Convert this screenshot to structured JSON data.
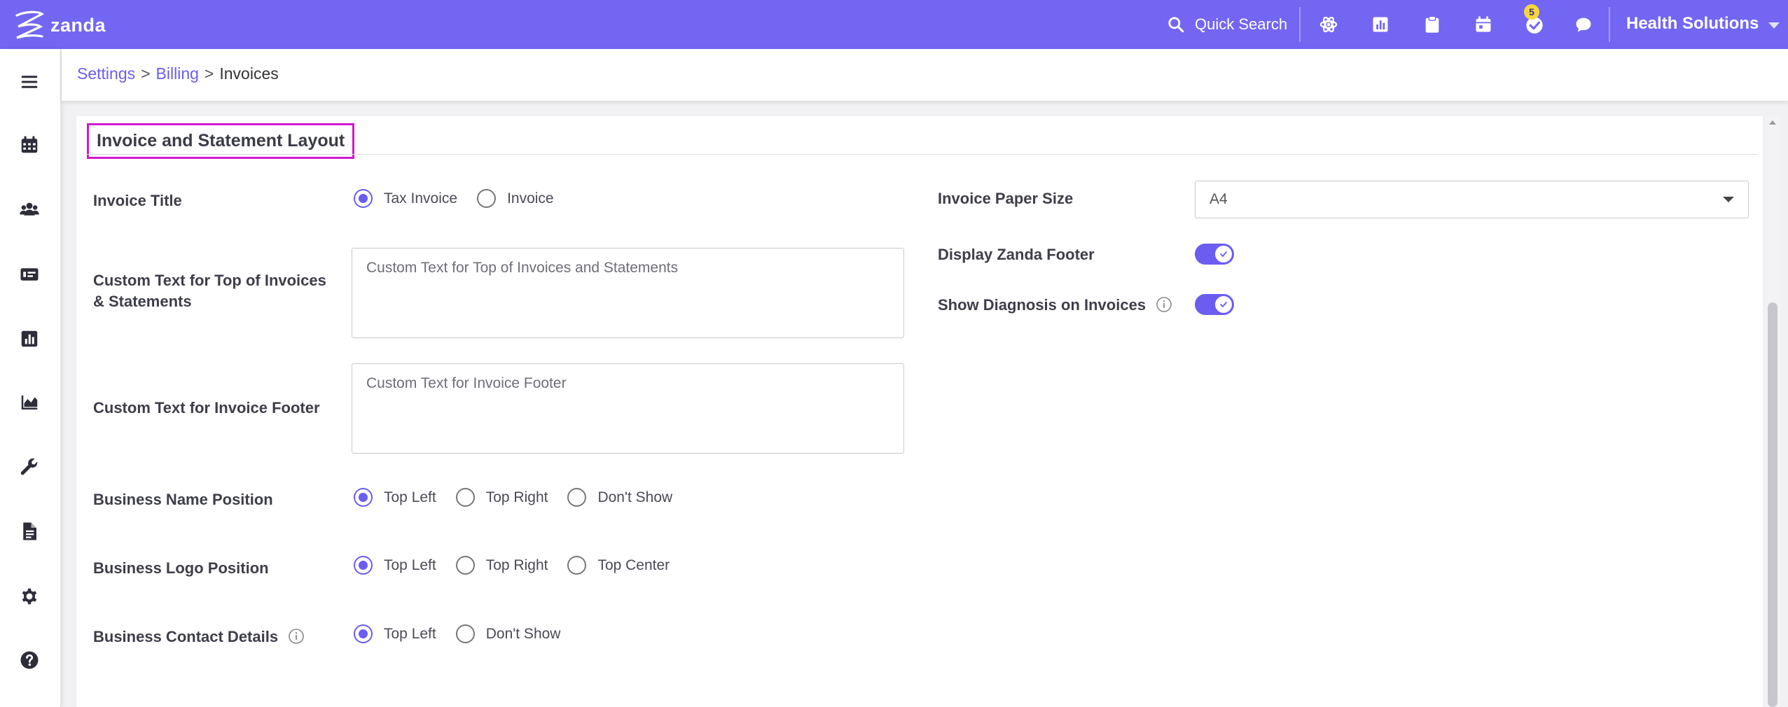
{
  "brand": {
    "name": "zanda",
    "accent": "#7266f3",
    "highlight": "#d317d0"
  },
  "topbar": {
    "quick_search": "Quick Search",
    "icons": [
      "apps-icon",
      "reports-icon",
      "clipboard-icon",
      "calendar-icon",
      "tasks-icon",
      "chat-icon"
    ],
    "tasks_badge": "5",
    "organization": "Health Solutions"
  },
  "sidebar": {
    "items": [
      "menu-icon",
      "calendar-icon",
      "clients-icon",
      "billing-icon",
      "reports-icon",
      "analytics-icon",
      "tools-icon",
      "documents-icon",
      "settings-icon",
      "help-icon"
    ]
  },
  "breadcrumb": {
    "settings": "Settings",
    "sep": ">",
    "billing": "Billing",
    "current": "Invoices"
  },
  "section": {
    "title": "Invoice and Statement Layout",
    "invoice_title": {
      "label": "Invoice Title",
      "options": [
        "Tax Invoice",
        "Invoice"
      ],
      "selected": "Tax Invoice"
    },
    "custom_top": {
      "label_line1": "Custom Text for Top of Invoices",
      "label_line2": "& Statements",
      "placeholder": "Custom Text for Top of Invoices and Statements"
    },
    "custom_footer": {
      "label": "Custom Text for Invoice Footer",
      "placeholder": "Custom Text for Invoice Footer"
    },
    "business_name_position": {
      "label": "Business Name Position",
      "options": [
        "Top Left",
        "Top Right",
        "Don't Show"
      ],
      "selected": "Top Left"
    },
    "business_logo_position": {
      "label": "Business Logo Position",
      "options": [
        "Top Left",
        "Top Right",
        "Top Center"
      ],
      "selected": "Top Left"
    },
    "business_contact_details": {
      "label": "Business Contact Details",
      "options": [
        "Top Left",
        "Don't Show"
      ],
      "selected": "Top Left"
    },
    "paper_size": {
      "label": "Invoice Paper Size",
      "value": "A4"
    },
    "display_footer": {
      "label": "Display Zanda Footer",
      "enabled": true
    },
    "show_diagnosis": {
      "label": "Show Diagnosis on Invoices",
      "enabled": true
    }
  }
}
